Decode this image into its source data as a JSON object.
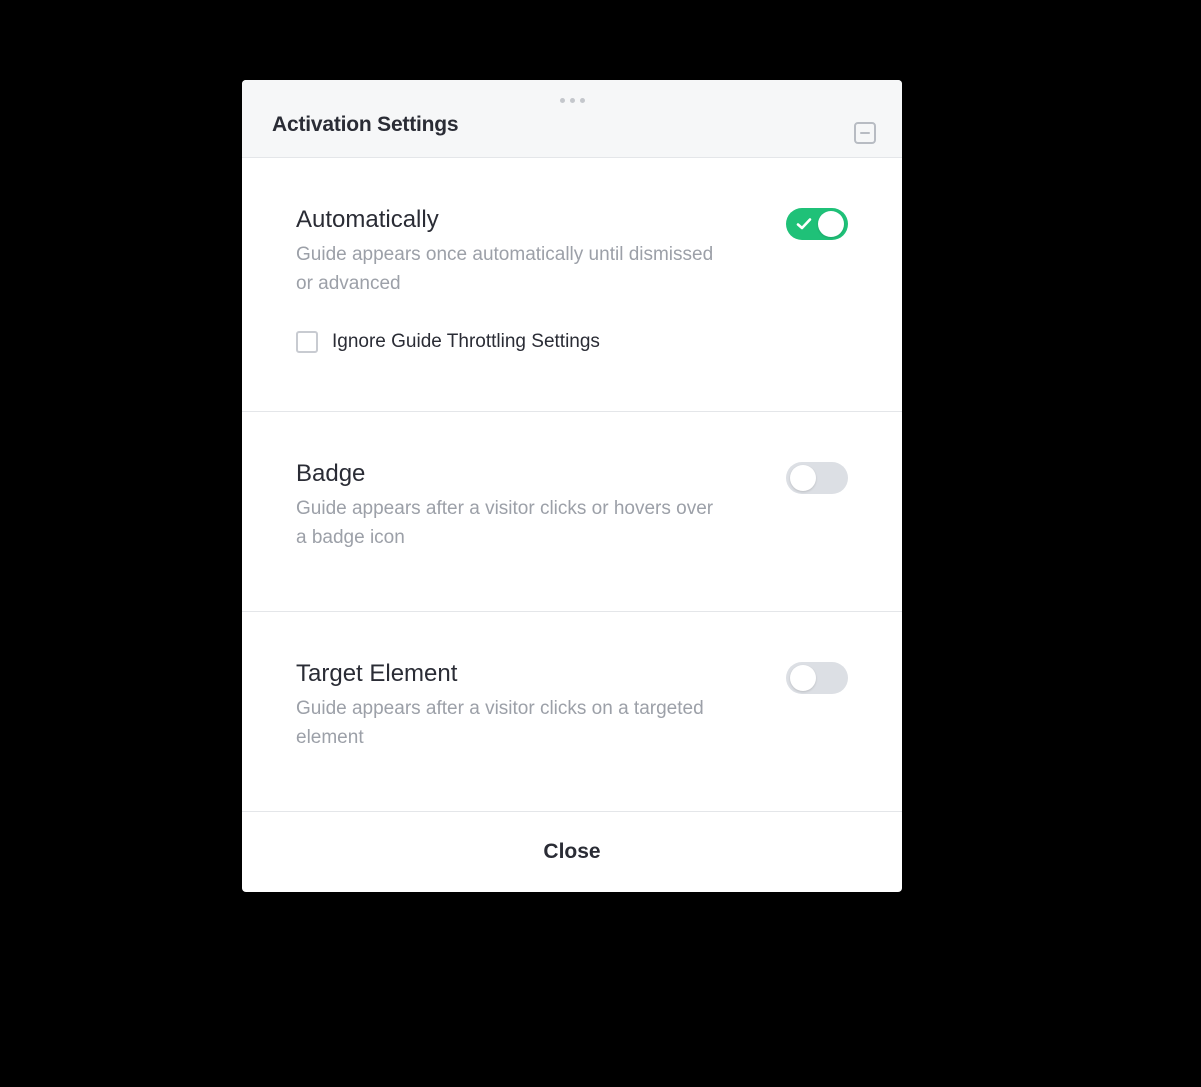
{
  "panel": {
    "title": "Activation Settings"
  },
  "sections": {
    "automatically": {
      "title": "Automatically",
      "description": "Guide appears once automatically until dismissed or advanced",
      "checkbox_label": "Ignore Guide Throttling Settings"
    },
    "badge": {
      "title": "Badge",
      "description": "Guide appears after a visitor clicks or hovers over a badge icon"
    },
    "target": {
      "title": "Target Element",
      "description": "Guide appears after a visitor clicks on a targeted element"
    }
  },
  "footer": {
    "close_label": "Close"
  }
}
